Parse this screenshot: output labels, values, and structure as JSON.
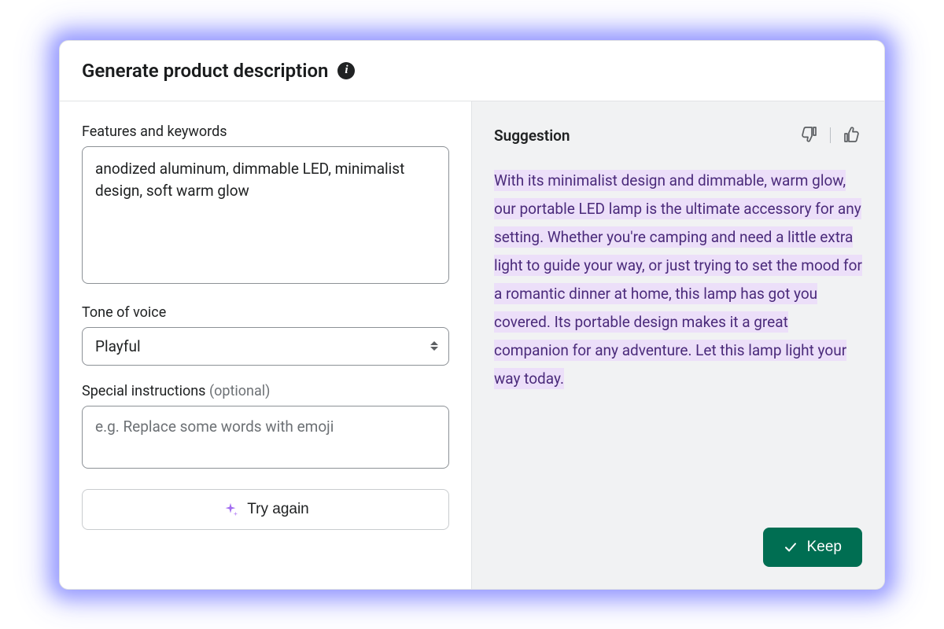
{
  "header": {
    "title": "Generate product description"
  },
  "form": {
    "features_label": "Features and keywords",
    "features_value": "anodized aluminum, dimmable LED, minimalist design, soft warm glow",
    "tone_label": "Tone of voice",
    "tone_value": "Playful",
    "tone_options": [
      "Playful"
    ],
    "special_label_main": "Special instructions ",
    "special_label_optional": "(optional)",
    "special_placeholder": "e.g. Replace some words with emoji",
    "special_value": "",
    "try_again_label": "Try again"
  },
  "suggestion": {
    "title": "Suggestion",
    "text": "With its minimalist design and dimmable, warm glow, our portable LED lamp is the ultimate accessory for any setting. Whether you're camping and need a little extra light to guide your way, or just trying to set the mood for a romantic dinner at home, this lamp has got you covered. Its portable design makes it a great companion for any adventure. Let this lamp light your way today.",
    "keep_label": "Keep"
  }
}
